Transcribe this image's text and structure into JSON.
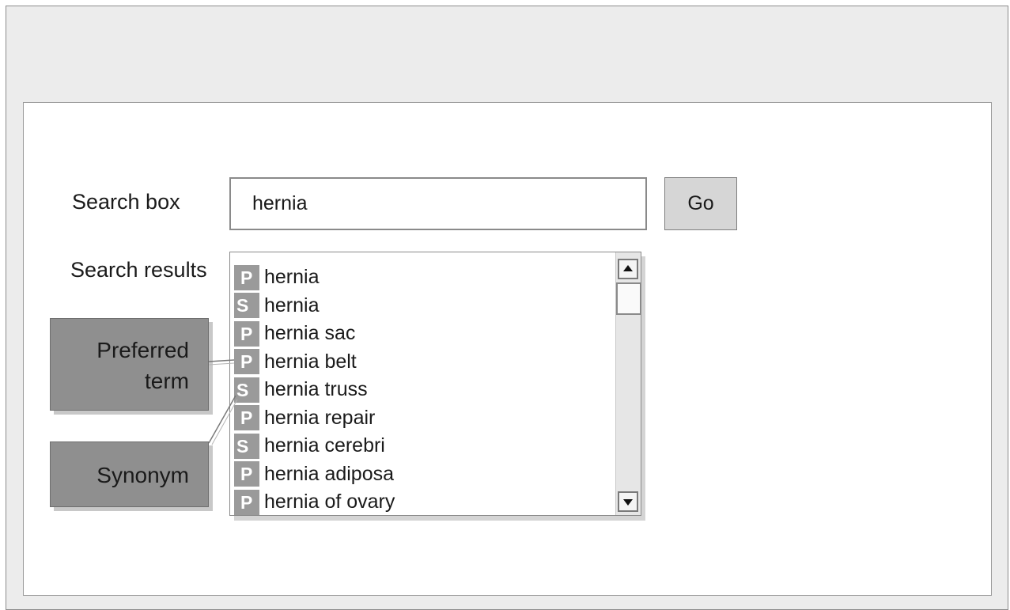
{
  "search": {
    "label": "Search box",
    "value": "hernia",
    "go_label": "Go"
  },
  "results": {
    "label": "Search results",
    "items": [
      {
        "type": "P",
        "term": "hernia"
      },
      {
        "type": "S",
        "term": "hernia"
      },
      {
        "type": "P",
        "term": "hernia sac"
      },
      {
        "type": "P",
        "term": "hernia belt"
      },
      {
        "type": "S",
        "term": "hernia truss"
      },
      {
        "type": "P",
        "term": "hernia repair"
      },
      {
        "type": "S",
        "term": "hernia cerebri"
      },
      {
        "type": "P",
        "term": "hernia adiposa"
      },
      {
        "type": "P",
        "term": "hernia of ovary"
      }
    ],
    "scroll_up_icon": "triangle-up",
    "scroll_down_icon": "triangle-down"
  },
  "callouts": {
    "preferred_line1": "Preferred",
    "preferred_line2": "term",
    "synonym": "Synonym"
  },
  "colors": {
    "badge": "#9a9a9a",
    "callout": "#8f8f8f",
    "frame": "#ececec"
  }
}
